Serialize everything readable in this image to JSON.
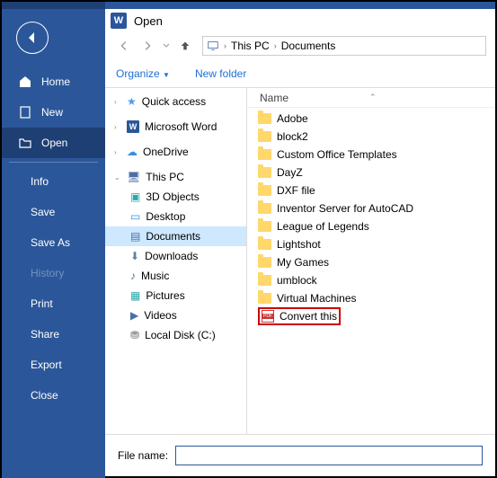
{
  "dialog_title": "Open",
  "breadcrumbs": {
    "root_icon": "pc",
    "path1": "This PC",
    "path2": "Documents"
  },
  "toolbar": {
    "organize": "Organize",
    "new_folder": "New folder"
  },
  "word_nav": {
    "home": "Home",
    "new": "New",
    "open": "Open",
    "info": "Info",
    "save": "Save",
    "save_as": "Save As",
    "history": "History",
    "print": "Print",
    "share": "Share",
    "export": "Export",
    "close": "Close"
  },
  "tree": {
    "quick_access": "Quick access",
    "ms_word": "Microsoft Word",
    "onedrive": "OneDrive",
    "this_pc": "This PC",
    "objects3d": "3D Objects",
    "desktop": "Desktop",
    "documents": "Documents",
    "downloads": "Downloads",
    "music": "Music",
    "pictures": "Pictures",
    "videos": "Videos",
    "local_disk": "Local Disk (C:)"
  },
  "columns": {
    "name": "Name"
  },
  "files": {
    "f0": "Adobe",
    "f1": "block2",
    "f2": "Custom Office Templates",
    "f3": "DayZ",
    "f4": "DXF file",
    "f5": "Inventor Server for AutoCAD",
    "f6": "League of Legends",
    "f7": "Lightshot",
    "f8": "My Games",
    "f9": "umblock",
    "f10": "Virtual Machines",
    "pdf": "Convert this"
  },
  "filename_label": "File name:",
  "filename_value": ""
}
